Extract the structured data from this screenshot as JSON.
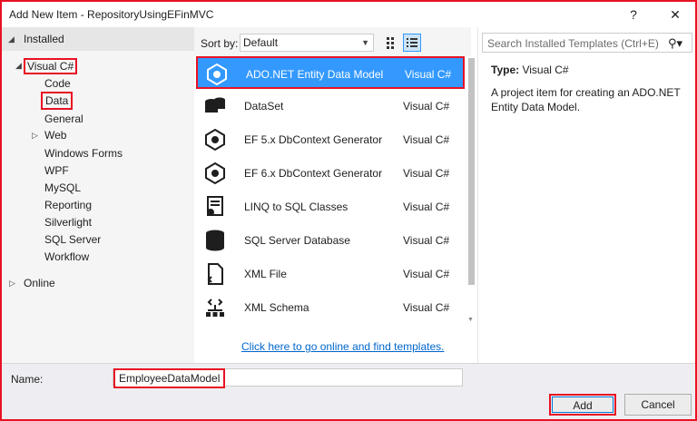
{
  "window": {
    "title": "Add New Item - RepositoryUsingEFinMVC",
    "help_label": "?",
    "close_label": "✕"
  },
  "tree": {
    "installed": "Installed",
    "visual_csharp": "Visual C#",
    "children": [
      "Code",
      "Data",
      "General",
      "Web",
      "Windows Forms",
      "WPF",
      "MySQL",
      "Reporting",
      "Silverlight",
      "SQL Server",
      "Workflow"
    ],
    "online": "Online"
  },
  "sort": {
    "label": "Sort by:",
    "value": "Default"
  },
  "templates": [
    {
      "name": "ADO.NET Entity Data Model",
      "lang": "Visual C#",
      "icon": "entity-model-icon",
      "selected": true
    },
    {
      "name": "DataSet",
      "lang": "Visual C#",
      "icon": "dataset-icon",
      "selected": false
    },
    {
      "name": "EF 5.x DbContext Generator",
      "lang": "Visual C#",
      "icon": "dbcontext-generator-icon",
      "selected": false
    },
    {
      "name": "EF 6.x DbContext Generator",
      "lang": "Visual C#",
      "icon": "dbcontext-generator-icon",
      "selected": false
    },
    {
      "name": "LINQ to SQL Classes",
      "lang": "Visual C#",
      "icon": "linq-to-sql-icon",
      "selected": false
    },
    {
      "name": "SQL Server Database",
      "lang": "Visual C#",
      "icon": "database-icon",
      "selected": false
    },
    {
      "name": "XML File",
      "lang": "Visual C#",
      "icon": "xml-file-icon",
      "selected": false
    },
    {
      "name": "XML Schema",
      "lang": "Visual C#",
      "icon": "xml-schema-icon",
      "selected": false
    }
  ],
  "online_link": "Click here to go online and find templates.",
  "search": {
    "placeholder": "Search Installed Templates (Ctrl+E)"
  },
  "details": {
    "type_label": "Type:",
    "type_value": "Visual C#",
    "description": "A project item for creating an ADO.NET Entity Data Model."
  },
  "bottom": {
    "name_label": "Name:",
    "name_value": "EmployeeDataModel",
    "add_label": "Add",
    "cancel_label": "Cancel"
  },
  "colors": {
    "selection": "#3399ff",
    "highlight_border": "#e81123",
    "link": "#0066cc"
  }
}
